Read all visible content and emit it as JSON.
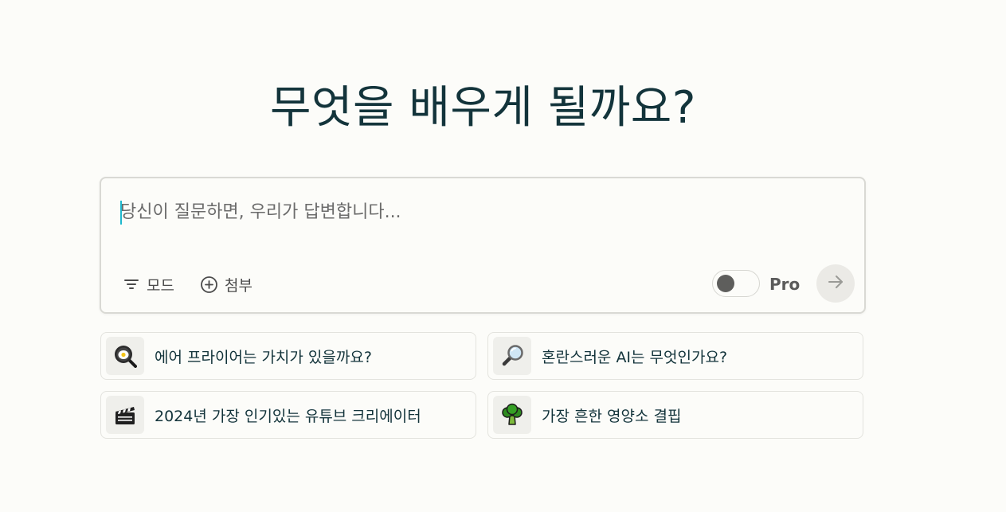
{
  "headline": "무엇을 배우게 될까요?",
  "composer": {
    "placeholder": "당신이 질문하면, 우리가 답변합니다...",
    "mode_label": "모드",
    "attach_label": "첨부",
    "pro_label": "Pro",
    "pro_enabled": false
  },
  "suggestions": [
    {
      "label": "에어 프라이어는 가치가 있을까요?",
      "icon": "frying-pan-egg-icon"
    },
    {
      "label": "혼란스러운 AI는 무엇인가요?",
      "icon": "magnifying-glass-icon"
    },
    {
      "label": "2024년 가장 인기있는 유튜브 크리에이터",
      "icon": "clapperboard-icon"
    },
    {
      "label": "가장 흔한 영양소 결핍",
      "icon": "broccoli-icon"
    }
  ],
  "colors": {
    "background": "#fcfcf9",
    "text": "#13343b",
    "caret": "#1fb8cd",
    "border": "#d9d9d4"
  }
}
